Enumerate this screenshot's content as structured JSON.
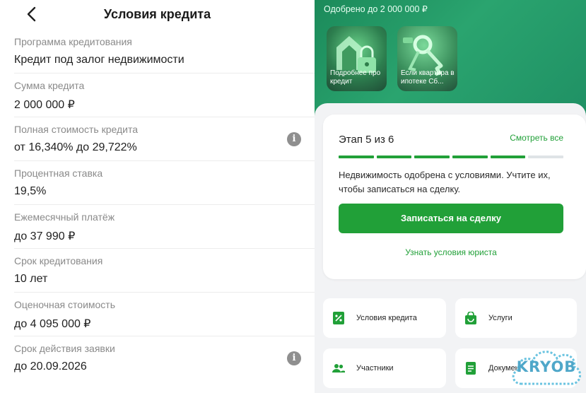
{
  "header": {
    "title": "Условия кредита"
  },
  "loan_details": [
    {
      "label": "Программа кредитования",
      "value": "Кредит под залог недвижимости",
      "info": false
    },
    {
      "label": "Сумма кредита",
      "value": "2 000 000 ₽",
      "info": false
    },
    {
      "label": "Полная стоимость кредита",
      "value": "от 16,340% до 29,722%",
      "info": true
    },
    {
      "label": "Процентная ставка",
      "value": "19,5%",
      "info": false
    },
    {
      "label": "Ежемесячный платёж",
      "value": "до 37 990 ₽",
      "info": false
    },
    {
      "label": "Срок кредитования",
      "value": "10 лет",
      "info": false
    },
    {
      "label": "Оценочная стоимость",
      "value": "до 4 095 000 ₽",
      "info": false
    },
    {
      "label": "Срок действия заявки",
      "value": "до 20.09.2026",
      "info": true
    }
  ],
  "info_icon": "i",
  "banner": {
    "approved_text": "Одобрено до 2 000 000 ₽",
    "stories": [
      {
        "caption": "Подробнее про кредит",
        "icon": "lock-house-icon"
      },
      {
        "caption": "Если квартира в ипотеке Сб...",
        "icon": "keys-icon"
      }
    ]
  },
  "stage_card": {
    "stage_label": "Этап 5 из 6",
    "see_all_label": "Смотреть все",
    "steps_total": 6,
    "steps_done": 5,
    "description": "Недвижимость одобрена с условиями. Учтите их, чтобы записаться на сделку.",
    "button_label": "Записаться на сделку",
    "link_label": "Узнать условия юриста"
  },
  "tiles": [
    {
      "label": "Условия кредита",
      "icon": "document-percent-icon"
    },
    {
      "label": "Услуги",
      "icon": "shopping-bag-icon"
    },
    {
      "label": "Участники",
      "icon": "people-icon"
    },
    {
      "label": "Документы",
      "icon": "document-icon"
    }
  ],
  "watermark": {
    "text": "KRYOB"
  },
  "colors": {
    "accent": "#21a038",
    "banner": "#1f9064",
    "muted_text": "#8a8a8a",
    "info_icon": "#8f8f8f"
  }
}
